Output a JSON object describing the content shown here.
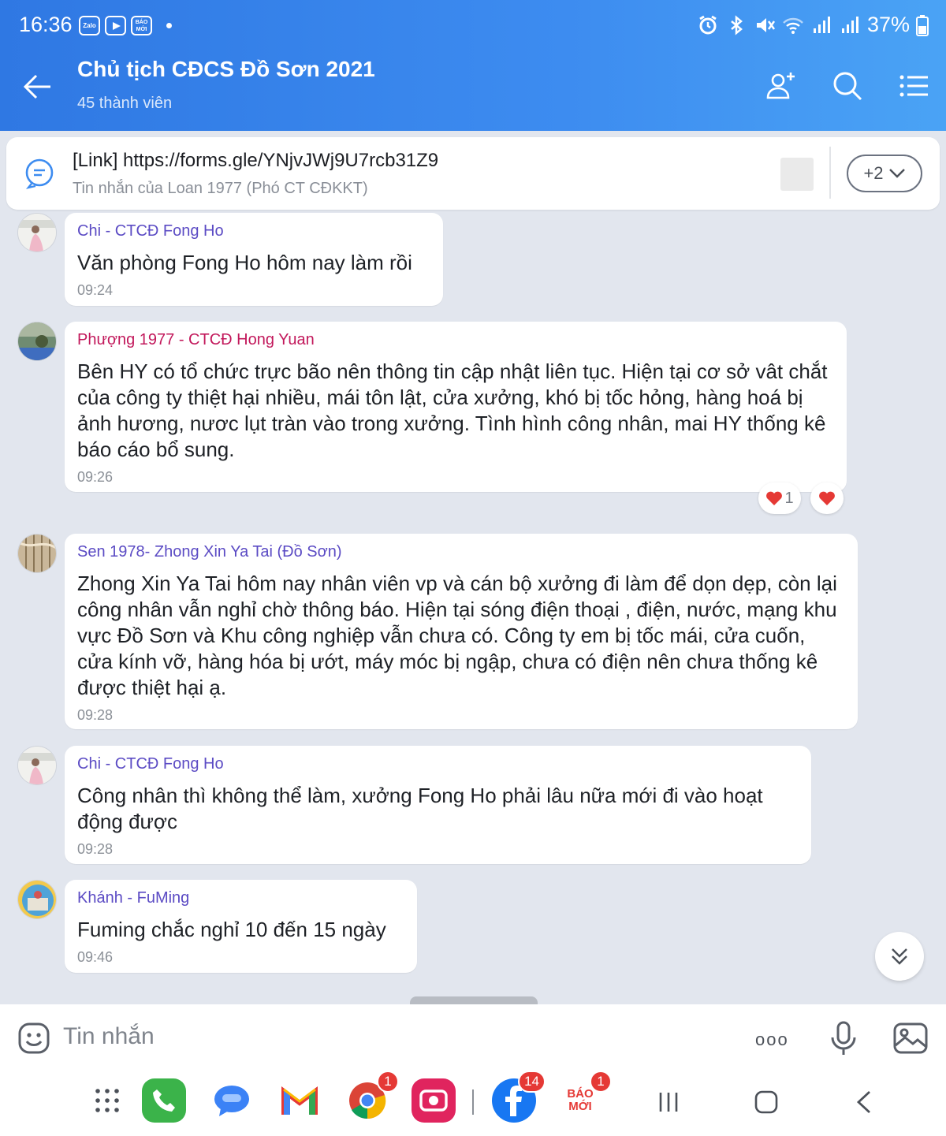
{
  "status_bar": {
    "time": "16:36",
    "apps": [
      "Zalo",
      "YouTube",
      "BÁO MỚI"
    ],
    "battery": "37%"
  },
  "header": {
    "title": "Chủ tịch CĐCS Đồ Sơn 2021",
    "subtitle": "45 thành viên",
    "icons": [
      "back-arrow-icon",
      "add-member-icon",
      "search-icon",
      "menu-list-icon"
    ]
  },
  "pinned": {
    "link": "[Link] https://forms.gle/YNjvJWj9U7rcb31Z9",
    "sub": "Tin nhắn của Loan 1977 (Phó CT CĐKKT)",
    "more": "+2"
  },
  "colors": {
    "header_start": "#2f78e3",
    "header_end": "#4aa3f5",
    "background": "#e2e6ee",
    "sender_blue": "#5b4bc4",
    "sender_pink": "#c2185b",
    "heart": "#e53935"
  },
  "messages": [
    {
      "sender": "Chi - CTCĐ Fong Ho",
      "text": "Văn phòng Fong Ho hôm nay làm rồi",
      "time": "09:24"
    },
    {
      "sender": "Phượng 1977 - CTCĐ Hong Yuan",
      "text": "Bên HY có tổ chức trực bão nên thông tin cập nhật liên tục. Hiện tại cơ sở vât chắt của công ty thiệt hại nhiều, mái tôn lật, cửa xưởng, khó bị tốc hỏng, hàng hoá bị ảnh hương, nươc lụt tràn vào trong xưởng. Tình hình công nhân, mai HY thống kê báo cáo bổ sung.",
      "time": "09:26",
      "reaction_count": "1"
    },
    {
      "sender": "Sen 1978- Zhong Xin Ya Tai (Đồ Sơn)",
      "text": "Zhong Xin Ya Tai hôm nay nhân viên vp và cán bộ xưởng đi làm để dọn dẹp, còn lại công nhân vẫn nghỉ chờ thông báo. Hiện tại sóng điện thoại , điện, nước, mạng khu vực Đồ Sơn và Khu công nghiệp vẫn chưa có. Công ty em bị tốc mái, cửa cuốn, cửa kính vỡ, hàng hóa bị ướt, máy móc bị ngập, chưa có điện nên chưa thống kê được thiệt hại ạ.",
      "time": "09:28"
    },
    {
      "sender": "Chi - CTCĐ Fong Ho",
      "text": "Công nhân thì không thể làm, xưởng Fong Ho phải lâu nữa mới đi vào hoạt động được",
      "time": "09:28"
    },
    {
      "sender": "Khánh - FuMing",
      "text": "Fuming chắc nghỉ 10 đến 15 ngày",
      "time": "09:46"
    }
  ],
  "composer": {
    "placeholder": "Tin nhắn",
    "more": "ooo"
  },
  "dock": {
    "badges": {
      "chrome": "1",
      "facebook": "14",
      "baomoi": "1"
    },
    "baomoi_label_1": "BÁO",
    "baomoi_label_2": "MỚI"
  }
}
